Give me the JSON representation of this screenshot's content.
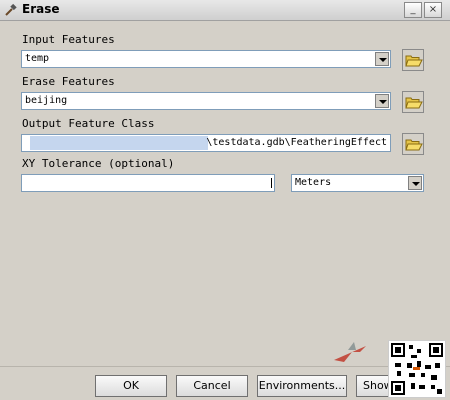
{
  "window": {
    "title": "Erase",
    "title_icon": "hammer-icon",
    "minimize_glyph": "_",
    "close_glyph": "×"
  },
  "fields": {
    "input_features": {
      "label": "Input Features",
      "value": "temp"
    },
    "erase_features": {
      "label": "Erase Features",
      "value": "beijing"
    },
    "output_feature_class": {
      "label": "Output Feature Class",
      "value": "\\testdata.gdb\\FeatheringEffect"
    },
    "xy_tolerance": {
      "label": "XY Tolerance (optional)",
      "value": "",
      "unit": "Meters"
    }
  },
  "buttons": {
    "ok": "OK",
    "cancel": "Cancel",
    "environments": "Environments...",
    "show_help": "Show"
  },
  "icons": {
    "browse": "folder-open-icon",
    "dropdown": "chevron-down-icon"
  },
  "colors": {
    "dialog_bg": "#d4d0c8",
    "field_border": "#7f9db9",
    "selection": "#c5d6ee"
  }
}
